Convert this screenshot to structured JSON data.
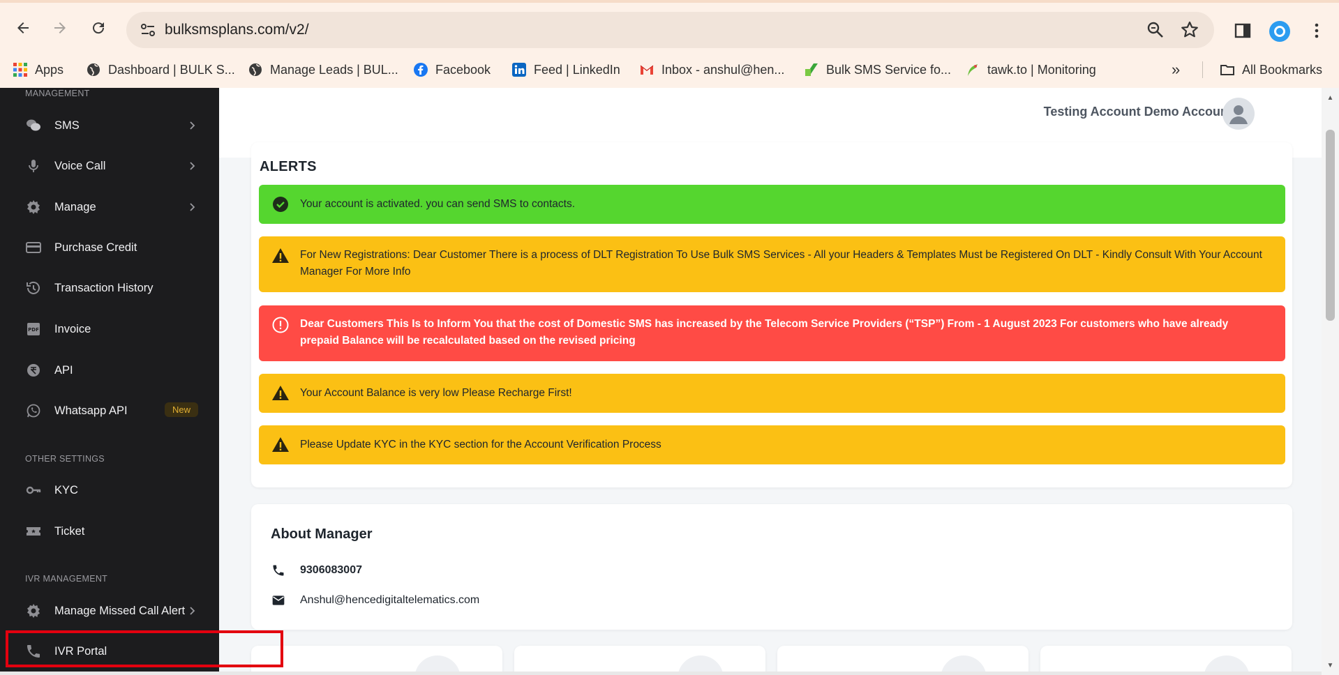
{
  "browser": {
    "url": "bulksmsplans.com/v2/",
    "bookmarks": [
      {
        "label": "Apps",
        "icon": "apps-grid-icon"
      },
      {
        "label": "Dashboard | BULK S...",
        "icon": "globe-icon"
      },
      {
        "label": "Manage Leads | BUL...",
        "icon": "globe-icon"
      },
      {
        "label": "Facebook",
        "icon": "facebook-icon"
      },
      {
        "label": "Feed | LinkedIn",
        "icon": "linkedin-icon"
      },
      {
        "label": "Inbox - anshul@hen...",
        "icon": "gmail-icon"
      },
      {
        "label": "Bulk SMS Service fo...",
        "icon": "bulksms-icon"
      },
      {
        "label": "tawk.to | Monitoring",
        "icon": "tawk-icon"
      }
    ],
    "all_bookmarks": "All Bookmarks"
  },
  "sidebar": {
    "section_management": "MANAGEMENT",
    "section_other": "OTHER SETTINGS",
    "section_ivr": "IVR MANAGEMENT",
    "items": {
      "sms": "SMS",
      "voice_call": "Voice Call",
      "manage": "Manage",
      "purchase_credit": "Purchase Credit",
      "transaction_history": "Transaction History",
      "invoice": "Invoice",
      "api": "API",
      "whatsapp_api": "Whatsapp API",
      "whatsapp_badge": "New",
      "kyc": "KYC",
      "ticket": "Ticket",
      "missed_call": "Manage Missed Call Alert",
      "ivr_portal": "IVR Portal"
    }
  },
  "header": {
    "user_name": "Testing Account Demo Account"
  },
  "alerts": {
    "title": "ALERTS",
    "items": [
      {
        "type": "success",
        "text": "Your account is activated. you can send SMS to contacts."
      },
      {
        "type": "warning",
        "text": "For New Registrations: Dear Customer There is a process of DLT Registration To Use Bulk SMS Services - All your Headers & Templates Must be Registered On DLT - Kindly Consult With Your Account Manager For More Info"
      },
      {
        "type": "error",
        "text": "Dear Customers This Is to Inform You that the cost of Domestic SMS has increased by the Telecom Service Providers (“TSP”) From - 1 August 2023 For customers who have already prepaid Balance will be recalculated based on the revised pricing"
      },
      {
        "type": "warning",
        "text": "Your Account Balance is very low Please Recharge First!"
      },
      {
        "type": "warning",
        "text": "Please Update KYC in the KYC section for the Account Verification Process"
      }
    ]
  },
  "about_manager": {
    "title": "About Manager",
    "phone": "9306083007",
    "email": "Anshul@hencedigitaltelematics.com"
  },
  "colors": {
    "sidebar_bg": "#1c1c1e",
    "success": "#55d62f",
    "warning": "#fbc014",
    "error": "#ff4b45",
    "highlight": "#e3000f"
  }
}
